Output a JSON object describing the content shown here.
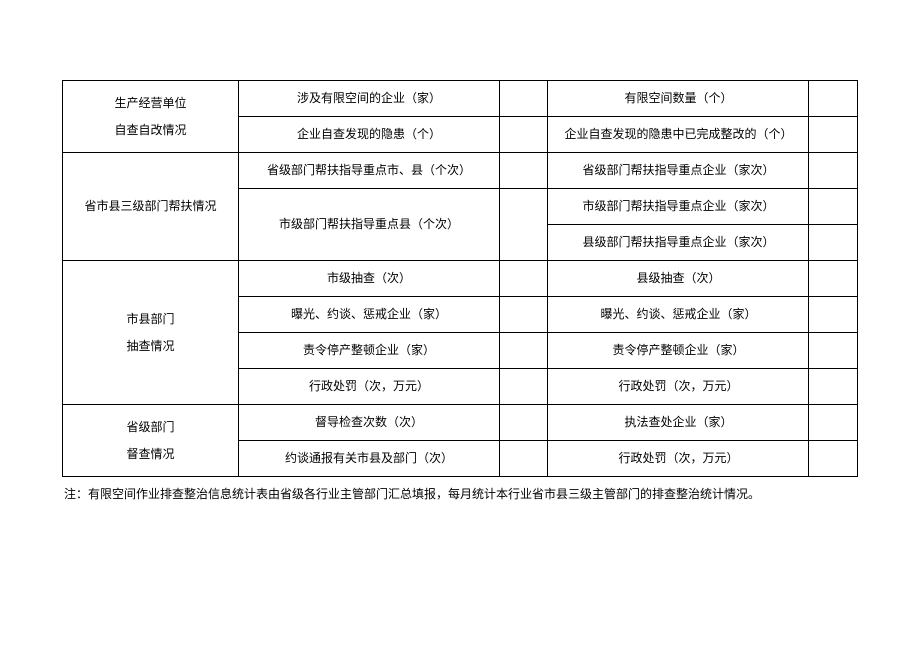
{
  "table": {
    "sections": [
      {
        "category": "生产经营单位\n自查自改情况",
        "rows": [
          {
            "left": "涉及有限空间的企业（家）",
            "left_val": "",
            "right": "有限空间数量（个）",
            "right_val": ""
          },
          {
            "left": "企业自查发现的隐患（个）",
            "left_val": "",
            "right": "企业自查发现的隐患中已完成整改的（个）",
            "right_val": ""
          }
        ]
      },
      {
        "category": "省市县三级部门帮扶情况",
        "rows": [
          {
            "left": "省级部门帮扶指导重点市、县（个次）",
            "left_val": "",
            "right": "省级部门帮扶指导重点企业（家次）",
            "right_val": ""
          },
          {
            "left": "市级部门帮扶指导重点县（个次）",
            "left_val": "",
            "right": "市级部门帮扶指导重点企业（家次）",
            "right_val": ""
          },
          {
            "left": "",
            "left_val": "",
            "right": "县级部门帮扶指导重点企业（家次）",
            "right_val": ""
          }
        ]
      },
      {
        "category": "市县部门\n抽查情况",
        "rows": [
          {
            "left": "市级抽查（次）",
            "left_val": "",
            "right": "县级抽查（次）",
            "right_val": ""
          },
          {
            "left": "曝光、约谈、惩戒企业（家）",
            "left_val": "",
            "right": "曝光、约谈、惩戒企业（家）",
            "right_val": ""
          },
          {
            "left": "责令停产整顿企业（家）",
            "left_val": "",
            "right": "责令停产整顿企业（家）",
            "right_val": ""
          },
          {
            "left": "行政处罚（次，万元）",
            "left_val": "",
            "right": "行政处罚（次，万元）",
            "right_val": ""
          }
        ]
      },
      {
        "category": "省级部门\n督查情况",
        "rows": [
          {
            "left": "督导检查次数（次）",
            "left_val": "",
            "right": "执法查处企业（家）",
            "right_val": ""
          },
          {
            "left": "约谈通报有关市县及部门（次）",
            "left_val": "",
            "right": "行政处罚（次，万元）",
            "right_val": ""
          }
        ]
      }
    ]
  },
  "note": "注：有限空间作业排查整治信息统计表由省级各行业主管部门汇总填报，每月统计本行业省市县三级主管部门的排查整治统计情况。"
}
